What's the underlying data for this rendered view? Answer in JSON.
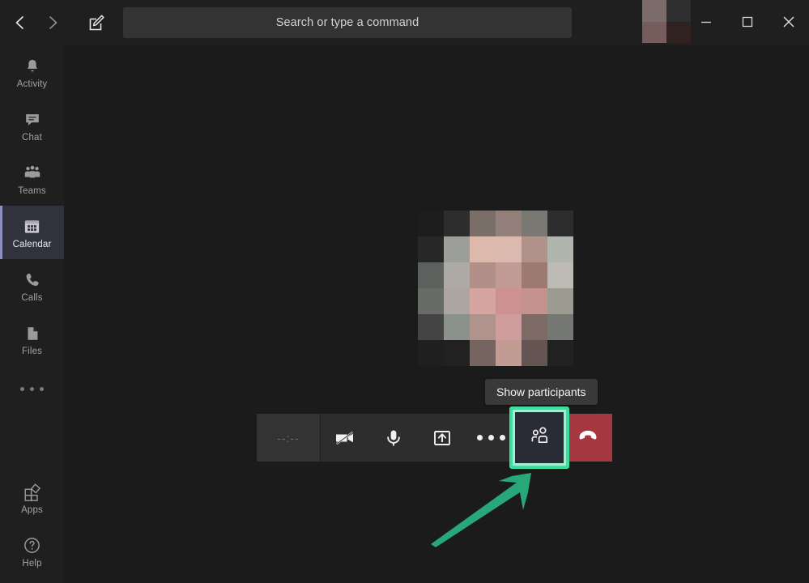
{
  "window": {
    "title_bar": {
      "back_button": "back-navigation",
      "forward_button": "forward-navigation",
      "compose_button": "new-conversation",
      "minimize_label": "Minimize",
      "maximize_label": "Maximize",
      "close_label": "Close"
    },
    "search": {
      "placeholder": "Search or type a command",
      "value": "Search or type a command"
    },
    "avatar_pixels": [
      "#7c6c69",
      "#2e2e2e",
      "#765c5b",
      "#2f2221"
    ]
  },
  "sidebar": {
    "items": [
      {
        "label": "Activity",
        "icon": "bell-icon",
        "selected": false
      },
      {
        "label": "Chat",
        "icon": "chat-icon",
        "selected": false
      },
      {
        "label": "Teams",
        "icon": "teams-icon",
        "selected": false
      },
      {
        "label": "Calendar",
        "icon": "calendar-icon",
        "selected": true
      },
      {
        "label": "Calls",
        "icon": "phone-icon",
        "selected": false
      },
      {
        "label": "Files",
        "icon": "files-icon",
        "selected": false
      }
    ],
    "more_label": "More options",
    "bottom_items": [
      {
        "label": "Apps",
        "icon": "apps-icon"
      },
      {
        "label": "Help",
        "icon": "help-icon"
      }
    ],
    "selected_accent": "#8f8fc4",
    "selected_bg": "#32323e"
  },
  "stage": {
    "background": "#1b1b1b",
    "video_pixels": [
      "#1d1d1d",
      "#2d2d2d",
      "#7a6f68",
      "#93807a",
      "#7a7873",
      "#2d2d2d",
      "#272727",
      "#9c9e99",
      "#dcb9ab",
      "#dcb9ae",
      "#b0928a",
      "#b0b5ae",
      "#5d615d",
      "#ada9a4",
      "#b2908a",
      "#c29b96",
      "#9d7a70",
      "#bcbab2",
      "#676c66",
      "#ada5a2",
      "#d7a59f",
      "#cd9192",
      "#c4918c",
      "#9b9b92",
      "#444444",
      "#8b928c",
      "#b0938c",
      "#d09d9e",
      "#7e6a65",
      "#757872",
      "#1f1f1f",
      "#212121",
      "#75645f",
      "#c29c92",
      "#645553",
      "#212121"
    ]
  },
  "tooltip": {
    "text": "Show participants",
    "background": "#393939"
  },
  "call_controls": {
    "timer": "--:--",
    "buttons": [
      {
        "name": "camera-off-button",
        "icon": "camera-off-icon",
        "label": "Turn camera on"
      },
      {
        "name": "microphone-button",
        "icon": "microphone-icon",
        "label": "Mute"
      },
      {
        "name": "share-screen-button",
        "icon": "share-screen-icon",
        "label": "Share"
      },
      {
        "name": "more-actions-button",
        "icon": "ellipsis-icon",
        "label": "More actions"
      },
      {
        "name": "show-participants-button",
        "icon": "participants-icon",
        "label": "Show participants"
      },
      {
        "name": "hangup-button",
        "icon": "hangup-icon",
        "label": "Hang up"
      }
    ],
    "hangup_color": "#a4373f",
    "bar_background": "#2d2d2d"
  },
  "annotation": {
    "highlight_color": "#3ddfa0",
    "highlight_inner_color": "#9ff0d0",
    "arrow_color": "#28a87a",
    "arrow_target": "show-participants-button"
  }
}
